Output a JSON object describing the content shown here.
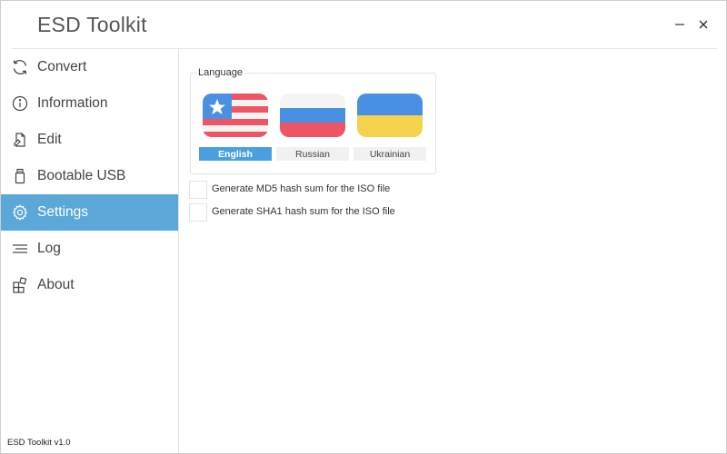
{
  "app": {
    "title": "ESD Toolkit",
    "version": "ESD Toolkit v1.0"
  },
  "window_controls": {
    "minimize": "—",
    "close": "✕"
  },
  "sidebar": {
    "items": [
      {
        "label": "Convert",
        "icon": "refresh-icon",
        "active": false
      },
      {
        "label": "Information",
        "icon": "info-icon",
        "active": false
      },
      {
        "label": "Edit",
        "icon": "edit-file-icon",
        "active": false
      },
      {
        "label": "Bootable USB",
        "icon": "usb-icon",
        "active": false
      },
      {
        "label": "Settings",
        "icon": "gear-icon",
        "active": true
      },
      {
        "label": "Log",
        "icon": "log-lines-icon",
        "active": false
      },
      {
        "label": "About",
        "icon": "about-blocks-icon",
        "active": false
      }
    ]
  },
  "settings": {
    "language_group_title": "Language",
    "languages": [
      {
        "label": "English",
        "flag": "us-flag-icon",
        "selected": true
      },
      {
        "label": "Russian",
        "flag": "russia-flag-icon",
        "selected": false
      },
      {
        "label": "Ukrainian",
        "flag": "ukraine-flag-icon",
        "selected": false
      }
    ],
    "options": [
      {
        "label": "Generate MD5 hash sum for the ISO file",
        "checked": false
      },
      {
        "label": "Generate SHA1 hash sum for the ISO file",
        "checked": false
      }
    ]
  },
  "colors": {
    "accent": "#5aa7d8",
    "language_selected": "#4aa0de",
    "flag_red": "#ef5465",
    "flag_blue": "#4a90e2",
    "flag_yellow": "#f5d24e"
  }
}
